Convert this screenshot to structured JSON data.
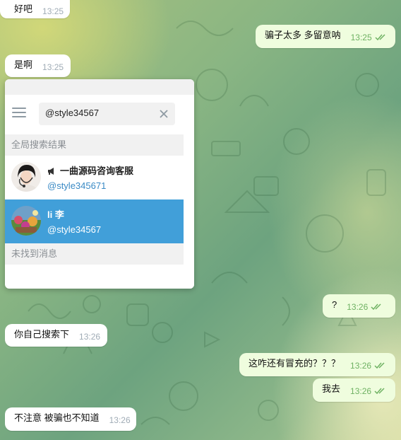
{
  "colors": {
    "incoming_bubble": "#ffffff",
    "outgoing_bubble": "#effdde",
    "selected_result": "#419fd9",
    "link_blue": "#3a8ac5",
    "check_green": "#6fb263"
  },
  "messages": [
    {
      "side": "in",
      "text": "好吧",
      "time": "13:25"
    },
    {
      "side": "out",
      "text": "骗子太多 多留意呐",
      "time": "13:25",
      "read": true
    },
    {
      "side": "in",
      "text": "是啊",
      "time": "13:25"
    },
    {
      "side": "out",
      "text": "?",
      "time": "13:26",
      "read": true
    },
    {
      "side": "in",
      "text": "你自己搜索下",
      "time": "13:26"
    },
    {
      "side": "out",
      "text": "这咋还有冒充的？？？",
      "time": "13:26",
      "read": true
    },
    {
      "side": "out",
      "text": "我去",
      "time": "13:26",
      "read": true
    },
    {
      "side": "in",
      "text": "不注意 被骗也不知道",
      "time": "13:26"
    }
  ],
  "search": {
    "query": "@style34567",
    "menu_icon": "hamburger-menu-icon",
    "clear_icon": "close-icon",
    "global_results_label": "全局搜索结果",
    "no_messages_label": "未找到消息",
    "results": [
      {
        "name": "一曲源码咨询客服",
        "username": "@style345671",
        "icon": "megaphone-icon",
        "selected": false
      },
      {
        "name": "li 李",
        "username": "@style34567",
        "selected": true
      }
    ]
  }
}
